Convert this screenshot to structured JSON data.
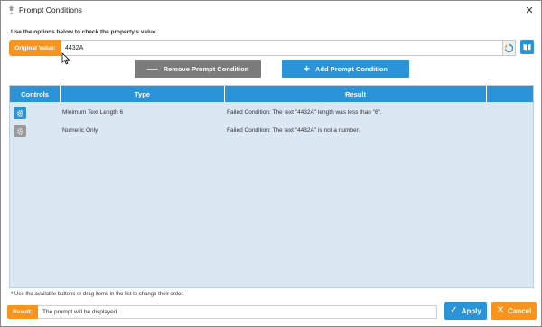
{
  "window": {
    "title": "Prompt Conditions"
  },
  "instruction": "Use the options below to check the property's value.",
  "original_value": {
    "label": "Original Value:",
    "value": "4432A"
  },
  "actions": {
    "remove_label": "Remove Prompt Condition",
    "add_label": "Add Prompt Condition"
  },
  "grid": {
    "headers": {
      "controls": "Controls",
      "type": "Type",
      "result": "Result",
      "extra": ""
    },
    "rows": [
      {
        "type": "Minimum Text Length 6",
        "result": "Failed Condition: The text \"4432A\" length was less than \"6\".",
        "gear_state": "active"
      },
      {
        "type": "Numeric Only",
        "result": "Failed Condition: The text \"4432A\" is not a number.",
        "gear_state": "inactive"
      }
    ]
  },
  "footnote": "* Use the available buttons or drag items in the list to change their order.",
  "result": {
    "label": "Result:",
    "value": "The prompt will be displayed"
  },
  "buttons": {
    "apply": "Apply",
    "cancel": "Cancel"
  },
  "colors": {
    "accent_blue": "#2b93d8",
    "accent_orange": "#f7941d",
    "grid_bg": "#dbe8f4",
    "muted_gray": "#7b7b7b"
  },
  "icons": {
    "app": "prompt-app-icon",
    "close": "close-icon",
    "refresh": "refresh-icon",
    "book": "book-icon",
    "minus": "minus-icon",
    "plus": "plus-icon",
    "gear": "gear-icon",
    "check": "check-icon",
    "x": "x-icon"
  }
}
